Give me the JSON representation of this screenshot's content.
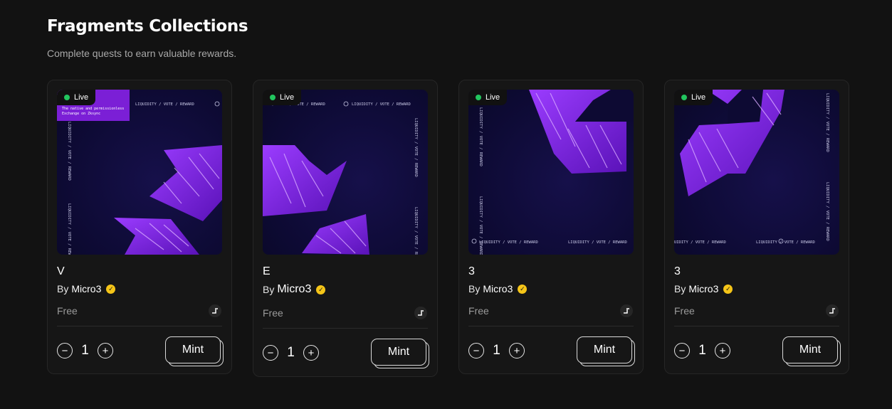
{
  "header": {
    "title": "Fragments Collections",
    "subtitle": "Complete quests to earn valuable rewards."
  },
  "art_text": {
    "border": "LIQUIDITY / VOTE / REWARD",
    "promo_line1": "The native and permissionless",
    "promo_line2": "Exchange on Zksync"
  },
  "colors": {
    "background": "#121212",
    "card": "#161616",
    "live_dot": "#22c55e",
    "verified": "#f5c518",
    "art_purple": "#7b1fd6"
  },
  "cards": [
    {
      "badge": "Live",
      "title": "V",
      "by_label": "By",
      "creator": "Micro3",
      "verified_icon": "check-badge-icon",
      "price": "Free",
      "chain_icon": "chain-logo-icon",
      "quantity": "1",
      "minus": "−",
      "plus": "+",
      "mint_label": "Mint"
    },
    {
      "badge": "Live",
      "title": "E",
      "by_label": "By",
      "creator": "Micro3",
      "verified_icon": "check-badge-icon",
      "price": "Free",
      "chain_icon": "chain-logo-icon",
      "quantity": "1",
      "minus": "−",
      "plus": "+",
      "mint_label": "Mint"
    },
    {
      "badge": "Live",
      "title": "3",
      "by_label": "By",
      "creator": "Micro3",
      "verified_icon": "check-badge-icon",
      "price": "Free",
      "chain_icon": "chain-logo-icon",
      "quantity": "1",
      "minus": "−",
      "plus": "+",
      "mint_label": "Mint"
    },
    {
      "badge": "Live",
      "title": "3",
      "by_label": "By",
      "creator": "Micro3",
      "verified_icon": "check-badge-icon",
      "price": "Free",
      "chain_icon": "chain-logo-icon",
      "quantity": "1",
      "minus": "−",
      "plus": "+",
      "mint_label": "Mint"
    }
  ]
}
